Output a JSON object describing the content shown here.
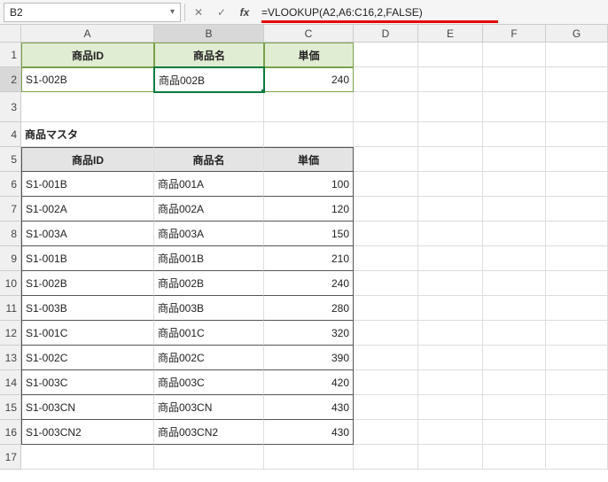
{
  "nameBox": "B2",
  "formula": "=VLOOKUP(A2,A6:C16,2,FALSE)",
  "columns": [
    "A",
    "B",
    "C",
    "D",
    "E",
    "F",
    "G"
  ],
  "row1": {
    "a": "商品ID",
    "b": "商品名",
    "c": "単価"
  },
  "row2": {
    "a": "S1-002B",
    "b": "商品002B",
    "c": "240"
  },
  "row4": {
    "a": "商品マスタ"
  },
  "row5": {
    "a": "商品ID",
    "b": "商品名",
    "c": "単価"
  },
  "master": [
    {
      "id": "S1-001B",
      "name": "商品001A",
      "price": "100"
    },
    {
      "id": "S1-002A",
      "name": "商品002A",
      "price": "120"
    },
    {
      "id": "S1-003A",
      "name": "商品003A",
      "price": "150"
    },
    {
      "id": "S1-001B",
      "name": "商品001B",
      "price": "210"
    },
    {
      "id": "S1-002B",
      "name": "商品002B",
      "price": "240"
    },
    {
      "id": "S1-003B",
      "name": "商品003B",
      "price": "280"
    },
    {
      "id": "S1-001C",
      "name": "商品001C",
      "price": "320"
    },
    {
      "id": "S1-002C",
      "name": "商品002C",
      "price": "390"
    },
    {
      "id": "S1-003C",
      "name": "商品003C",
      "price": "420"
    },
    {
      "id": "S1-003CN",
      "name": "商品003CN",
      "price": "430"
    },
    {
      "id": "S1-003CN2",
      "name": "商品003CN2",
      "price": "430"
    }
  ],
  "rowNumbers": [
    "1",
    "2",
    "3",
    "4",
    "5",
    "6",
    "7",
    "8",
    "9",
    "10",
    "11",
    "12",
    "13",
    "14",
    "15",
    "16",
    "17"
  ]
}
